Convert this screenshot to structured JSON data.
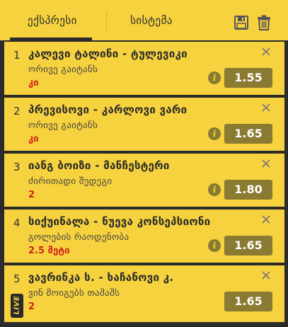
{
  "tabs": {
    "express": "ექსპრესი",
    "system": "სისტემა"
  },
  "header_icons": [
    "save-icon",
    "trash-icon"
  ],
  "bets": [
    {
      "num": "1",
      "teams": "კალევი ტალინი - ტულევიკი",
      "market": "ორივე გაიტანს",
      "pick": "კი",
      "odds": "1.55",
      "live": false
    },
    {
      "num": "2",
      "teams": "პრევისოვი - კარლოვი ვარი",
      "market": "ორივე გაიტანს",
      "pick": "კი",
      "odds": "1.65",
      "live": false
    },
    {
      "num": "3",
      "teams": "იანგ ბოიზი - მანჩესტერი",
      "market": "ძირითადი შედეგი",
      "pick": "2",
      "odds": "1.80",
      "live": false
    },
    {
      "num": "4",
      "teams": "სიქუინალა - ნუევა კონსეპსიონი",
      "market": "გოლების რაოდენობა",
      "pick": "2.5 მეტი",
      "odds": "1.65",
      "live": false
    },
    {
      "num": "5",
      "teams": "ვავრინკა ს. - ხაჩანოვი კ.",
      "market": "ვინ მოიგებს თამაშს",
      "pick": "2",
      "odds": "1.65",
      "live": true
    }
  ],
  "live_label": "LIVE",
  "info_glyph": "i",
  "colors": {
    "panel": "#f6d23e",
    "background": "#2b2b2b",
    "odds_box": "#8a7a32",
    "pick_red": "#d0231a"
  }
}
